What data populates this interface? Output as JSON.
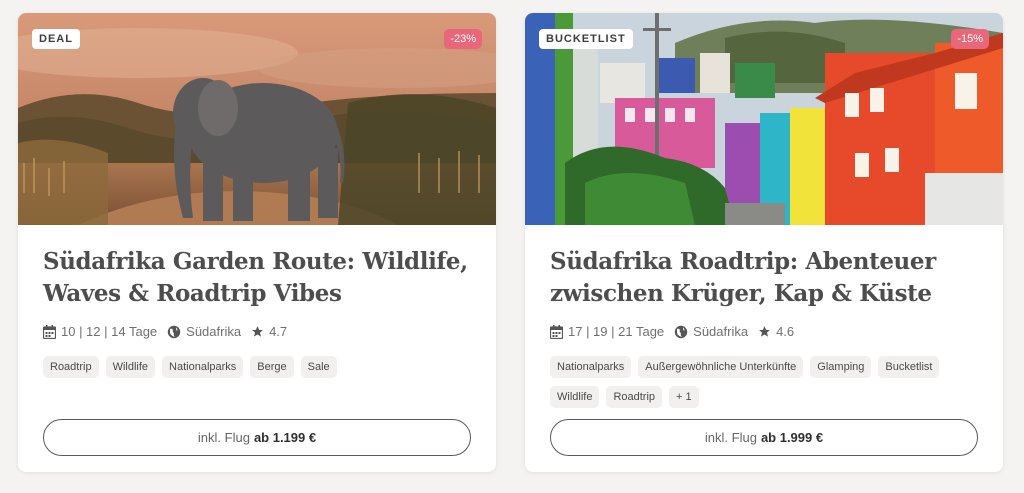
{
  "cards": [
    {
      "badge": "DEAL",
      "discount": "-23%",
      "title": "Südafrika Garden Route: Wildlife, Waves & Roadtrip Vibes",
      "duration": "10 | 12 | 14 Tage",
      "country": "Südafrika",
      "rating": "4.7",
      "tags": [
        "Roadtrip",
        "Wildlife",
        "Nationalparks",
        "Berge",
        "Sale"
      ],
      "price_prefix": "inkl. Flug",
      "price": "ab 1.199 €",
      "image_icon": "elephant-savanna-photo"
    },
    {
      "badge": "BUCKETLIST",
      "discount": "-15%",
      "title": "Südafrika Roadtrip: Abenteuer zwischen Krüger, Kap & Küste",
      "duration": "17 | 19 | 21 Tage",
      "country": "Südafrika",
      "rating": "4.6",
      "tags": [
        "Nationalparks",
        "Außergewöhnliche Unterkünfte",
        "Glamping",
        "Bucketlist",
        "Wildlife",
        "Roadtrip",
        "+ 1"
      ],
      "price_prefix": "inkl. Flug",
      "price": "ab 1.999 €",
      "image_icon": "colorful-houses-photo"
    }
  ],
  "colors": {
    "background": "#f4f3f1",
    "discount": "#e9677a",
    "tag_bg": "#f1f0ee"
  },
  "icons": {
    "duration": "calendar-icon",
    "country": "globe-icon",
    "rating": "star-icon"
  }
}
